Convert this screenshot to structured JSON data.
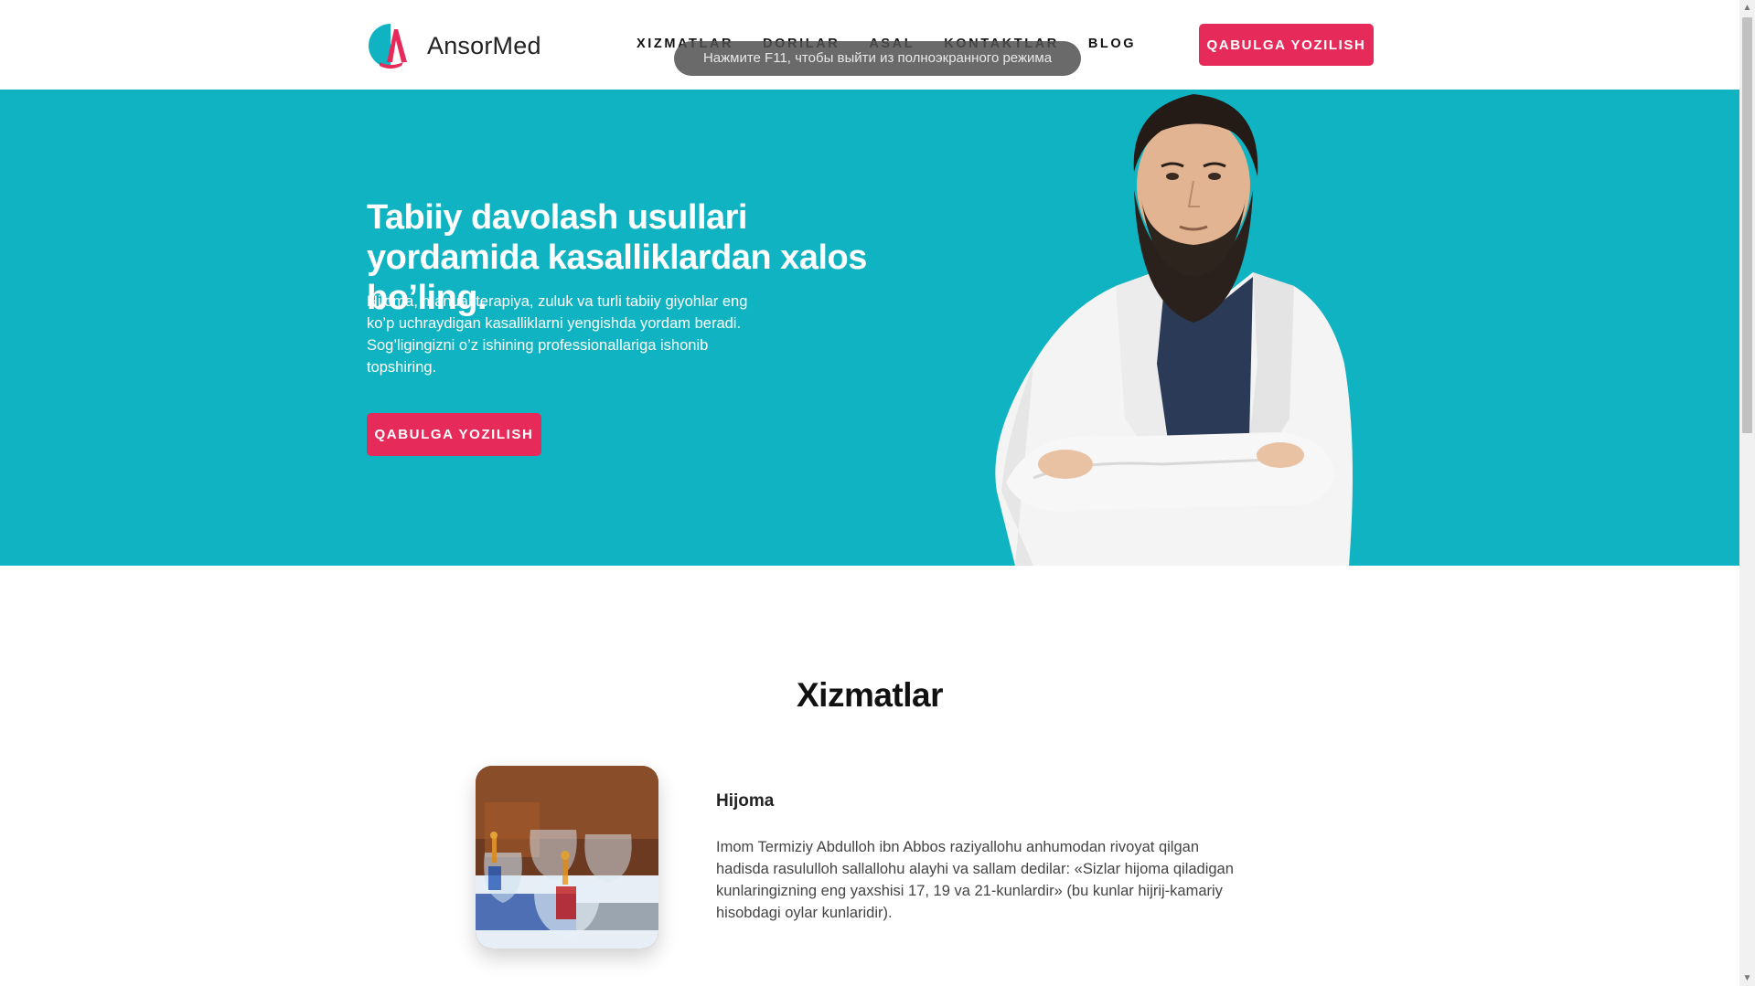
{
  "header": {
    "brand": "AnsorMed",
    "nav": [
      "XIZMATLAR",
      "DORILAR",
      "ASAL",
      "KONTAKTLAR",
      "BLOG"
    ],
    "cta": "QABULGA YOZILISH"
  },
  "fullscreen_notice": "Нажмите F11, чтобы выйти из полноэкранного режима",
  "hero": {
    "title": "Tabiiy davolash usullari yordamida kasalliklardan xalos bo’ling.",
    "text": "Hijoma, manual terapiya, zuluk va turli tabiiy giyohlar eng ko’p uchraydigan kasalliklarni yengishda yordam beradi. Sog’ligingizni o’z ishining professionallariga ishonib topshiring.",
    "cta": "QABULGA YOZILISH"
  },
  "services": {
    "title": "Xizmatlar",
    "items": [
      {
        "name": "Hijoma",
        "description": "Imom Termiziy Abdulloh ibn Abbos raziyallohu anhumodan rivoyat qilgan hadisda rasululloh sallallohu alayhi va sallam dedilar: «Sizlar hijoma qiladigan kunlaringizning eng yaxshisi 17, 19 va 21-kunlardir» (bu kunlar hijrij-kamariy hisobdagi oylar kunlaridir)."
      }
    ]
  },
  "colors": {
    "accent": "#e62b5a",
    "hero_bg": "#10b3c1"
  }
}
